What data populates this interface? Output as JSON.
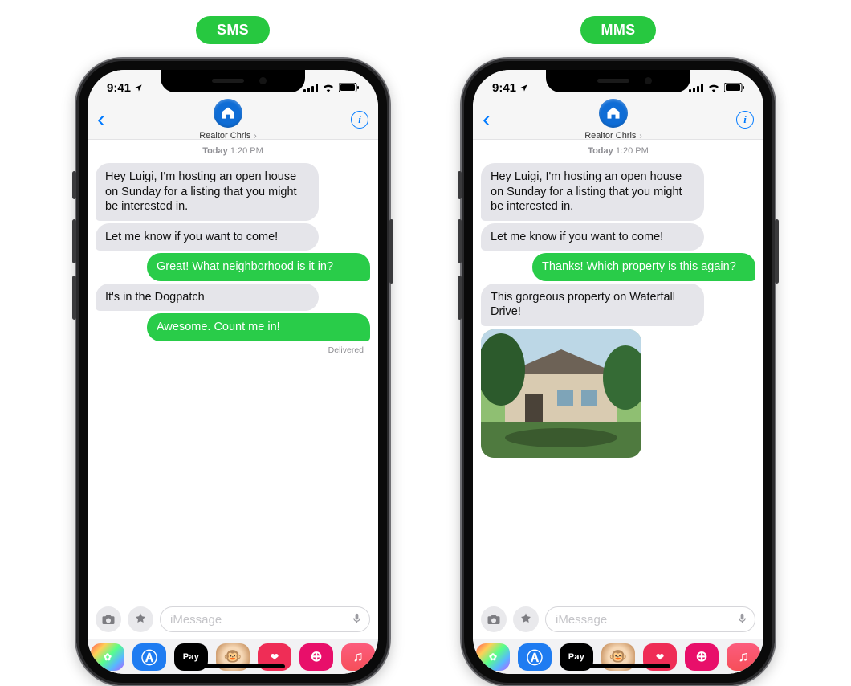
{
  "labels": {
    "sms": "SMS",
    "mms": "MMS"
  },
  "status": {
    "time": "9:41"
  },
  "contact": {
    "name": "Realtor Chris"
  },
  "timeline": {
    "day": "Today",
    "time": "1:20 PM"
  },
  "compose": {
    "placeholder": "iMessage"
  },
  "apps": {
    "pay": "Pay"
  },
  "phones": [
    {
      "id": "sms",
      "messages": [
        {
          "dir": "in",
          "text": "Hey Luigi, I'm hosting an open house on Sunday for a listing that you might be interested in."
        },
        {
          "dir": "in",
          "text": "Let me know if you want to come!"
        },
        {
          "dir": "out",
          "text": "Great! What neighborhood is it in?"
        },
        {
          "dir": "in",
          "text": "It's in the Dogpatch"
        },
        {
          "dir": "out",
          "text": "Awesome. Count me in!"
        }
      ],
      "delivered": "Delivered"
    },
    {
      "id": "mms",
      "messages": [
        {
          "dir": "in",
          "text": "Hey Luigi, I'm hosting an open house on Sunday for a listing that you might be interested in."
        },
        {
          "dir": "in",
          "text": "Let me know if you want to come!"
        },
        {
          "dir": "out",
          "text": "Thanks! Which property is this again?"
        },
        {
          "dir": "in",
          "text": "This gorgeous property on Waterfall Drive!"
        },
        {
          "dir": "image"
        }
      ],
      "delivered": ""
    }
  ]
}
